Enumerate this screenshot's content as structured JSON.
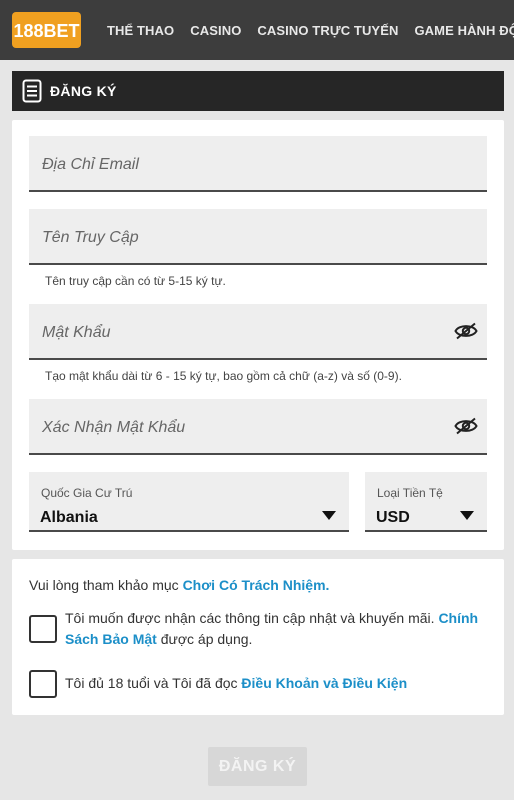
{
  "header": {
    "logo_text": "188BET",
    "nav": [
      "THỂ THAO",
      "CASINO",
      "CASINO TRỰC TUYẾN",
      "GAME HÀNH ĐỘNG"
    ]
  },
  "section": {
    "title": "ĐĂNG KÝ",
    "icon": "document-icon"
  },
  "form": {
    "email_placeholder": "Địa Chỉ Email",
    "username_placeholder": "Tên Truy Cập",
    "username_hint": "Tên truy cập cần có từ 5-15 ký tự.",
    "password_placeholder": "Mật Khẩu",
    "password_hint": "Tạo mật khẩu dài từ 6 - 15 ký tự, bao gồm cả chữ (a-z) và số (0-9).",
    "confirm_placeholder": "Xác Nhận Mật Khẩu",
    "country_label": "Quốc Gia Cư Trú",
    "country_value": "Albania",
    "currency_label": "Loại Tiền Tệ",
    "currency_value": "USD"
  },
  "consent": {
    "notice_text": "Vui lòng tham khảo mục ",
    "notice_link": "Chơi Có Trách Nhiệm.",
    "promo_line1_text": "Tôi muốn được nhận các thông tin cập nhật và khuyến mãi. ",
    "promo_line1_link": "Chính",
    "promo_line2_link": "Sách Bảo Mật",
    "promo_line2_text": " được áp dụng.",
    "age_text": "Tôi đủ 18 tuổi và Tôi đã đọc ",
    "age_link": "Điều Khoản và Điều Kiện"
  },
  "submit_label": "ĐĂNG KÝ",
  "colors": {
    "topbar": "#3d3d3d",
    "logo_bg": "#f0a020",
    "link": "#1c8fc8",
    "header_bar": "#262626",
    "disabled_button": "#d7d7d7"
  }
}
